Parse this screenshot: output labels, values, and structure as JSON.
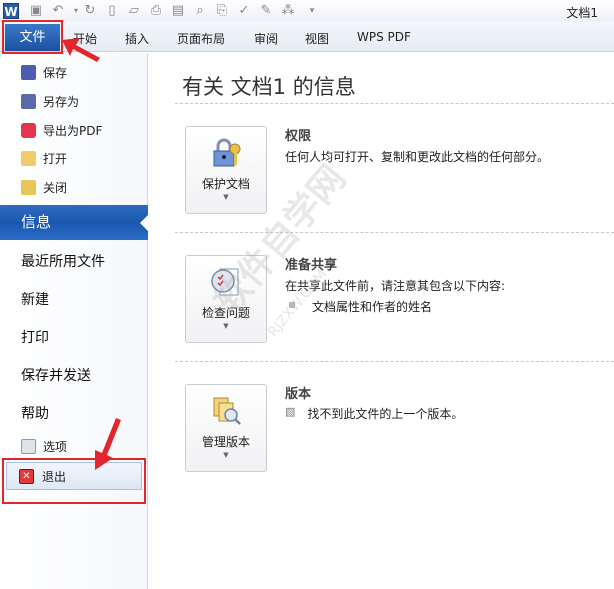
{
  "window": {
    "app_icon": "W",
    "doc_title": "文档1"
  },
  "quick_access": [
    "save-icon",
    "undo-icon",
    "redo-icon",
    "new-icon",
    "open-icon",
    "print-icon",
    "screenshot-icon",
    "print-preview-icon",
    "attach-icon",
    "spell-check-icon",
    "edit-icon",
    "structure-icon",
    "customize-icon"
  ],
  "tabs": [
    "文件",
    "开始",
    "插入",
    "页面布局",
    "审阅",
    "视图",
    "WPS PDF"
  ],
  "sidebar": {
    "small_items": [
      {
        "label": "保存",
        "icon": "save-icon"
      },
      {
        "label": "另存为",
        "icon": "save-as-icon"
      },
      {
        "label": "导出为PDF",
        "icon": "pdf-icon"
      },
      {
        "label": "打开",
        "icon": "open-folder-icon"
      },
      {
        "label": "关闭",
        "icon": "close-folder-icon"
      }
    ],
    "selected": "信息",
    "big_items": [
      "最近所用文件",
      "新建",
      "打印",
      "保存并发送",
      "帮助"
    ],
    "options": "选项",
    "exit": "退出"
  },
  "main": {
    "title": "有关 文档1 的信息",
    "sections": [
      {
        "button": "保护文档",
        "heading": "权限",
        "desc": "任何人均可打开、复制和更改此文档的任何部分。"
      },
      {
        "button": "检查问题",
        "heading": "准备共享",
        "desc": "在共享此文件前，请注意其包含以下内容:",
        "bullet": "文档属性和作者的姓名"
      },
      {
        "button": "管理版本",
        "heading": "版本",
        "desc": "找不到此文件的上一个版本。"
      }
    ]
  },
  "watermark": {
    "text": "软件自学网",
    "url": "RJZXW.COM"
  },
  "colors": {
    "accent": "#1d50a0",
    "highlight": "#e3262b"
  }
}
